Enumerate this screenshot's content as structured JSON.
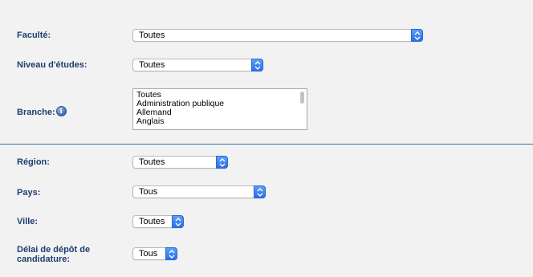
{
  "form": {
    "faculte": {
      "label": "Faculté:",
      "value": "Toutes"
    },
    "niveau": {
      "label": "Niveau d'études:",
      "value": "Toutes"
    },
    "branche": {
      "label": "Branche:",
      "options": [
        "Toutes",
        "Administration publique",
        "Allemand",
        "Anglais"
      ]
    },
    "region": {
      "label": "Région:",
      "value": "Toutes"
    },
    "pays": {
      "label": "Pays:",
      "value": "Tous"
    },
    "ville": {
      "label": "Ville:",
      "value": "Toutes"
    },
    "delai": {
      "label_line1": "Délai de dépôt de",
      "label_line2": "candidature:",
      "value": "Tous"
    }
  },
  "icons": {
    "info": "info-icon",
    "select_arrows": "chevron-updown-icon"
  },
  "colors": {
    "label": "#1d3d70",
    "accent": "#2c6fe6",
    "divider": "#2e6fa8",
    "background": "#f3f2f2"
  }
}
